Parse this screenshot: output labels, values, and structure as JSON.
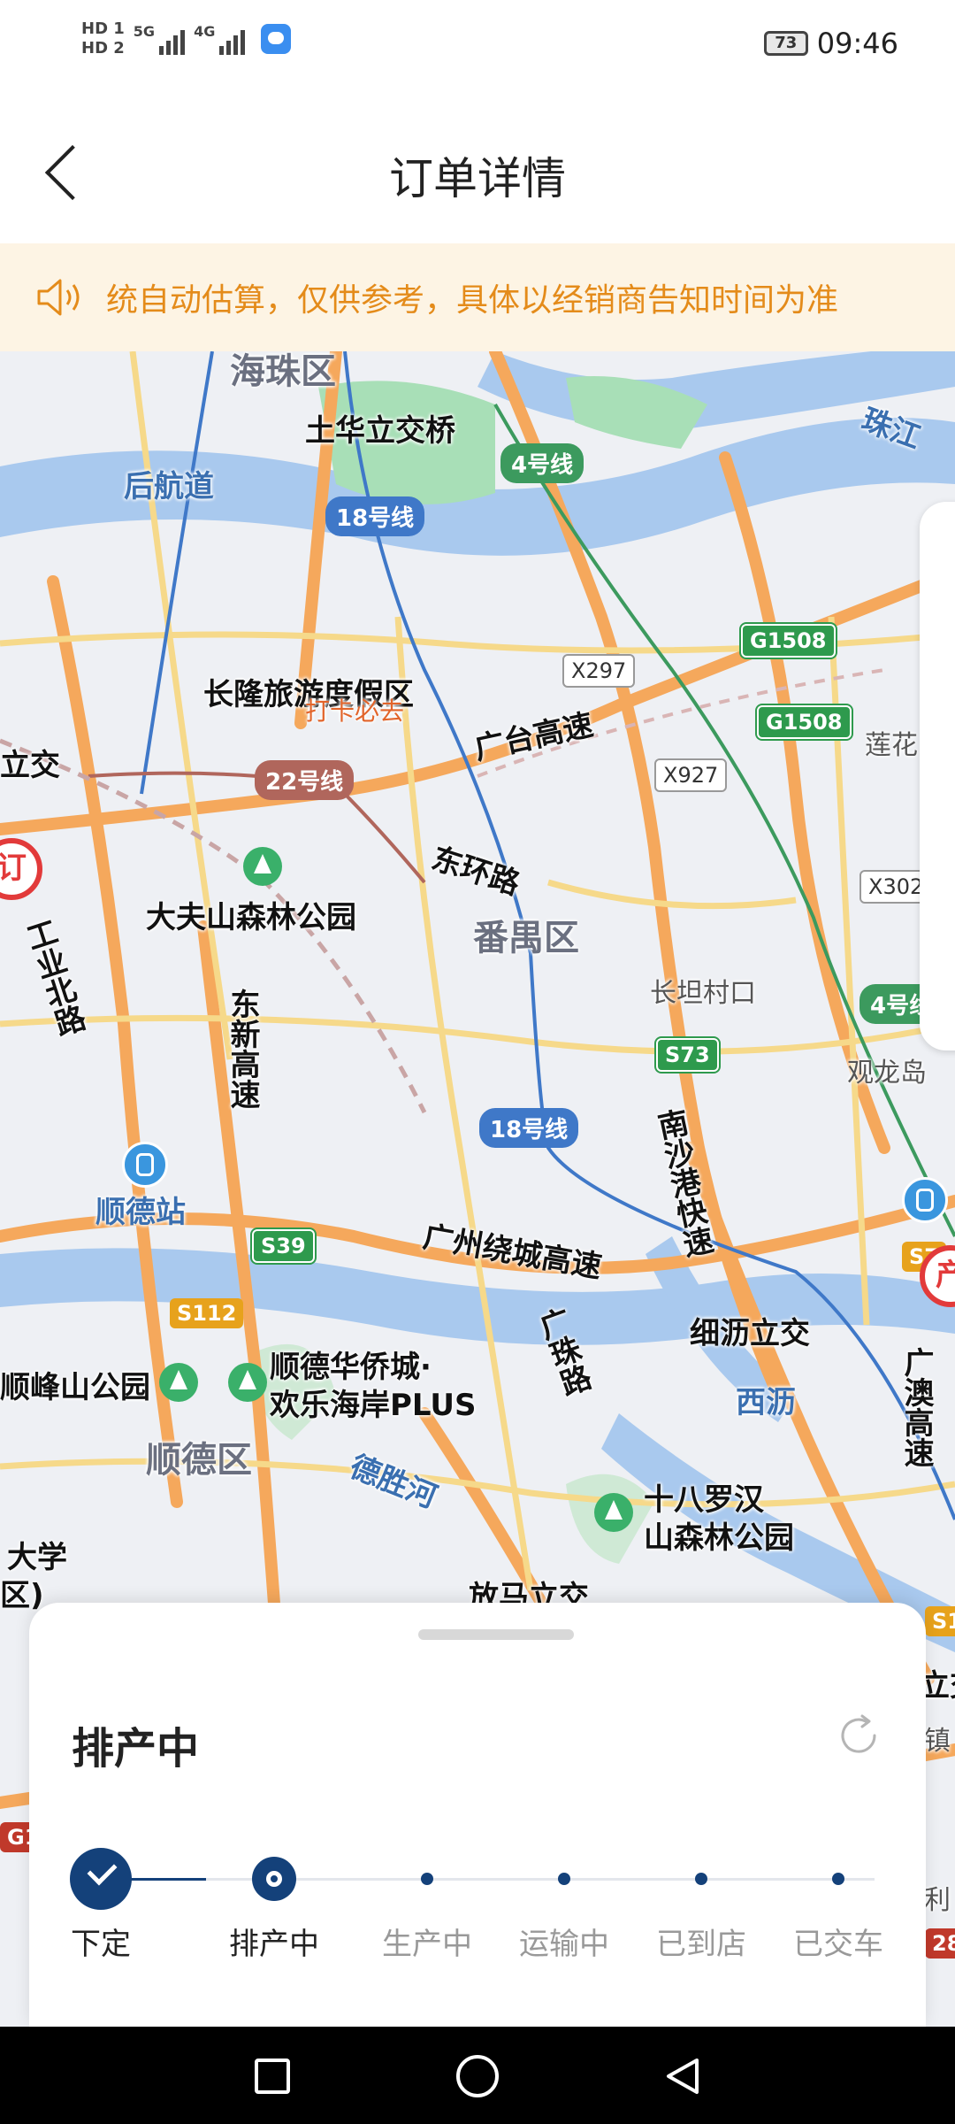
{
  "status_bar": {
    "hd1": "HD 1",
    "hd2": "HD 2",
    "net1": "5G",
    "net2": "4G",
    "battery": "73",
    "time": "09:46"
  },
  "header": {
    "title": "订单详情"
  },
  "notice": {
    "text": "统自动估算，仅供参考，具体以经销商告知时间为准"
  },
  "map": {
    "districts": [
      "海珠区",
      "番禺区",
      "顺德区"
    ],
    "roads": [
      "土华立交桥",
      "后航道",
      "广台高速",
      "东环路",
      "东新高速",
      "工业北路",
      "南沙港快速",
      "广州绕城高速",
      "广珠路",
      "细沥立交",
      "广澳高速",
      "放马立交",
      "立交"
    ],
    "water": [
      "珠江",
      "德胜河",
      "西沥"
    ],
    "places": [
      "长隆旅游度假区",
      "大夫山森林公园",
      "长坦村口",
      "顺德站",
      "顺德华侨城·",
      "欢乐海岸PLUS",
      "十八罗汉",
      "山森林公园",
      "顺峰山公园",
      "大学",
      "区)",
      "莲花",
      "观龙岛",
      "立交",
      "镇",
      "利"
    ],
    "tags": [
      "打卡必去"
    ],
    "metro": [
      "4号线",
      "18号线",
      "22号线",
      "18号线",
      "4号线"
    ],
    "shields": [
      "G1508",
      "G1508",
      "X297",
      "X927",
      "X302",
      "S73",
      "S39",
      "S112",
      "S1",
      "G1",
      "28",
      "S7"
    ],
    "pins": [
      "订",
      "产"
    ]
  },
  "sheet": {
    "status_title": "排产中",
    "steps": [
      {
        "label": "下定",
        "state": "done"
      },
      {
        "label": "排产中",
        "state": "current"
      },
      {
        "label": "生产中",
        "state": "future"
      },
      {
        "label": "运输中",
        "state": "future"
      },
      {
        "label": "已到店",
        "state": "future"
      },
      {
        "label": "已交车",
        "state": "future"
      }
    ]
  },
  "colors": {
    "accent": "#14417a",
    "notice_bg": "#fdf4e4",
    "notice_text": "#e48b1a"
  }
}
